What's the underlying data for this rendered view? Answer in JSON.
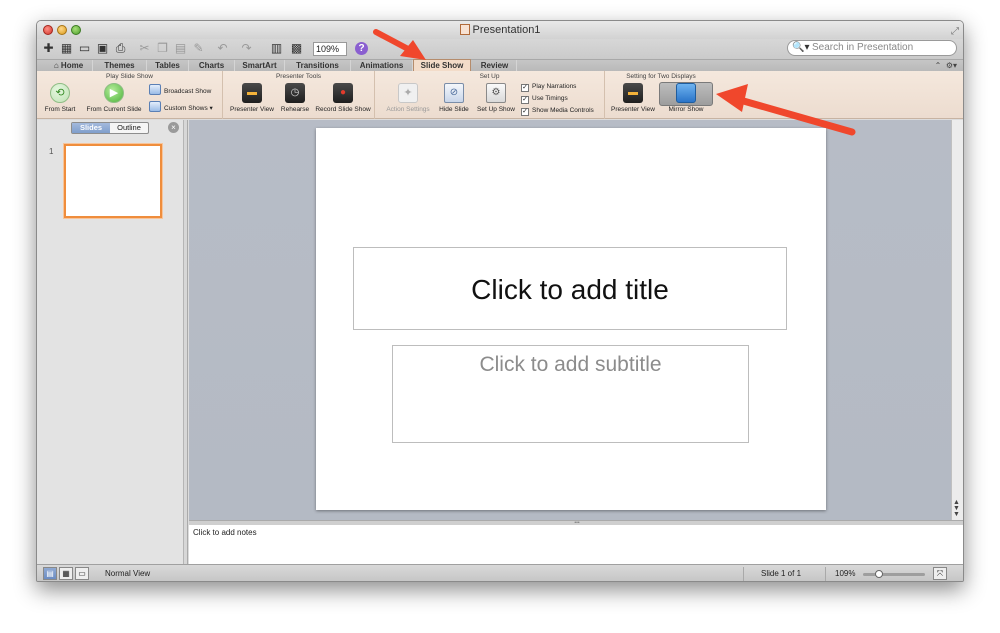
{
  "window": {
    "title": "Presentation1"
  },
  "toolbar": {
    "zoom": "109%",
    "search_placeholder": "Search in Presentation",
    "icons": [
      "new-slide-icon",
      "templates-icon",
      "open-icon",
      "save-icon",
      "print-icon",
      "cut-icon",
      "copy-icon",
      "paste-icon",
      "format-icon",
      "undo-icon",
      "redo-icon",
      "slide-sorter-icon",
      "media-icon",
      "help-icon"
    ]
  },
  "tabs": [
    {
      "label": "Home"
    },
    {
      "label": "Themes"
    },
    {
      "label": "Tables"
    },
    {
      "label": "Charts"
    },
    {
      "label": "SmartArt"
    },
    {
      "label": "Transitions"
    },
    {
      "label": "Animations"
    },
    {
      "label": "Slide Show",
      "active": true
    },
    {
      "label": "Review"
    }
  ],
  "ribbon": {
    "play": {
      "title": "Play Slide Show",
      "from_start": "From Start",
      "from_current": "From Current Slide",
      "broadcast": "Broadcast Show",
      "custom": "Custom Shows"
    },
    "presenter": {
      "title": "Presenter Tools",
      "presenter_view": "Presenter View",
      "rehearse": "Rehearse",
      "record": "Record Slide Show"
    },
    "setup": {
      "title": "Set Up",
      "action_settings": "Action Settings",
      "hide_slide": "Hide Slide",
      "set_up_show": "Set Up Show",
      "checks": [
        {
          "label": "Play Narrations",
          "checked": true
        },
        {
          "label": "Use Timings",
          "checked": true
        },
        {
          "label": "Show Media Controls",
          "checked": true
        }
      ]
    },
    "displays": {
      "title": "Setting for Two Displays",
      "presenter_view": "Presenter View",
      "mirror_show": "Mirror Show"
    }
  },
  "leftpane": {
    "tab_slides": "Slides",
    "tab_outline": "Outline",
    "slide_number": "1"
  },
  "slide": {
    "title_placeholder": "Click to add title",
    "subtitle_placeholder": "Click to add subtitle"
  },
  "notes": {
    "placeholder": "Click to add notes"
  },
  "status": {
    "view_name": "Normal View",
    "slide_count": "Slide 1 of 1",
    "zoom": "109%"
  },
  "colors": {
    "accent_tab": "#f3dcc9",
    "thumbnail_border": "#ef8d3c",
    "arrow": "#f0472c"
  }
}
